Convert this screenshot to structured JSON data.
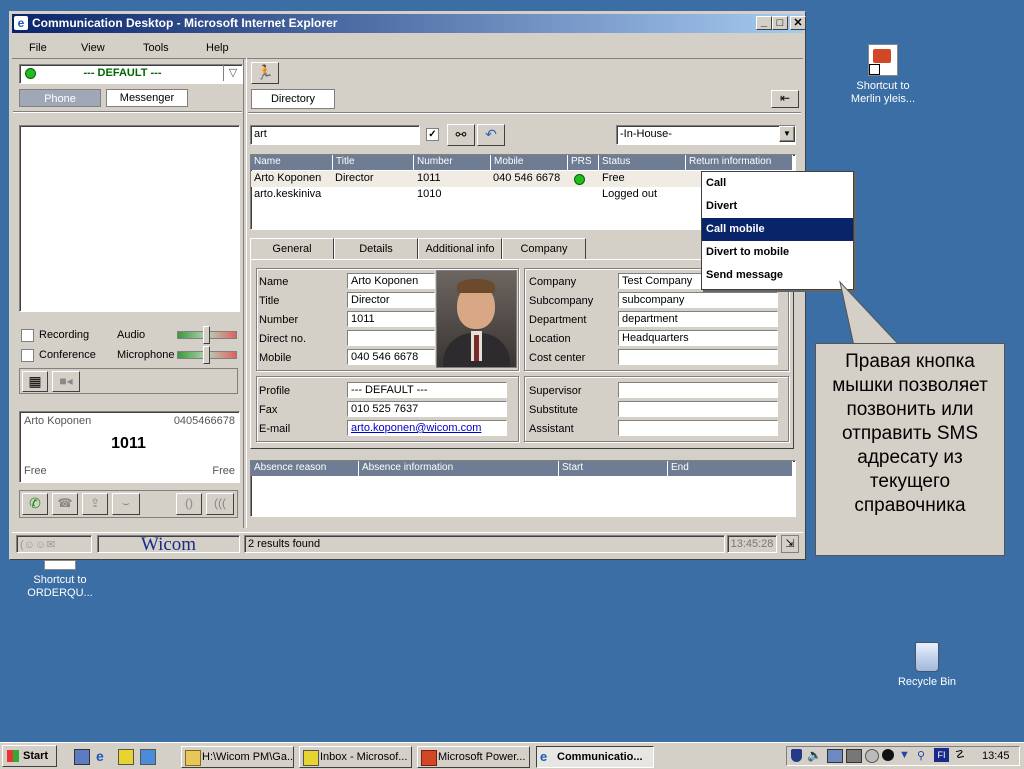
{
  "window": {
    "title": "Communication Desktop - Microsoft Internet Explorer"
  },
  "menu": [
    "File",
    "View",
    "Tools",
    "Help"
  ],
  "profile": {
    "selected": "--- DEFAULT ---"
  },
  "left_tabs": {
    "phone": "Phone",
    "messenger": "Messenger"
  },
  "options": {
    "recording": "Recording",
    "conference": "Conference",
    "audio": "Audio",
    "microphone": "Microphone"
  },
  "call_panel": {
    "name": "Arto Koponen",
    "mobile": "0405466678",
    "number": "1011",
    "status_left": "Free",
    "status_right": "Free"
  },
  "directory": {
    "tab": "Directory",
    "search_value": "art",
    "location": "-In-House-",
    "columns": [
      "Name",
      "Title",
      "Number",
      "Mobile",
      "PRS",
      "Status",
      "Return information"
    ],
    "rows": [
      {
        "name": "Arto Koponen",
        "title": "Director",
        "number": "1011",
        "mobile": "040 546 6678",
        "status": "Free",
        "presence_color": "#22bb22"
      },
      {
        "name": "arto.keskiniva",
        "title": "",
        "number": "1010",
        "mobile": "",
        "status": "Logged out",
        "presence_color": ""
      }
    ]
  },
  "context_menu": {
    "items": [
      "Call",
      "Divert",
      "Call mobile",
      "Divert to mobile",
      "Send message"
    ],
    "highlighted": "Call mobile"
  },
  "detail_tabs": [
    "General",
    "Details",
    "Additional info",
    "Company"
  ],
  "general": {
    "labels": {
      "name": "Name",
      "title": "Title",
      "number": "Number",
      "direct": "Direct no.",
      "mobile": "Mobile",
      "profile": "Profile",
      "fax": "Fax",
      "email": "E-mail"
    },
    "values": {
      "name": "Arto Koponen",
      "title": "Director",
      "number": "1011",
      "direct": "",
      "mobile": "040 546 6678",
      "profile": "--- DEFAULT ---",
      "fax": "010 525 7637",
      "email": "arto.koponen@wicom.com"
    }
  },
  "company": {
    "labels": {
      "company": "Company",
      "subcompany": "Subcompany",
      "department": "Department",
      "location": "Location",
      "cost_center": "Cost center",
      "supervisor": "Supervisor",
      "substitute": "Substitute",
      "assistant": "Assistant"
    },
    "values": {
      "company": "Test Company",
      "subcompany": "subcompany",
      "department": "department",
      "location": "Headquarters",
      "cost_center": "",
      "supervisor": "",
      "substitute": "",
      "assistant": ""
    }
  },
  "absence_columns": [
    "Absence reason",
    "Absence information",
    "Start",
    "End"
  ],
  "status_bar": {
    "brand": "Wicom",
    "results": "2 results found",
    "time": "13:45:28"
  },
  "callout": {
    "text": "Правая кнопка мышки позволяет позвонить или отправить SMS адресату из текущего справочника"
  },
  "desktop_icons": {
    "merlin": "Shortcut to Merlin yleis...",
    "order": "Shortcut to ORDERQU...",
    "recycle": "Recycle Bin"
  },
  "taskbar": {
    "start": "Start",
    "tasks": [
      "H:\\Wicom PM\\Ga...",
      "Inbox - Microsof...",
      "Microsoft Power...",
      "Communicatio..."
    ],
    "active_task": "Communicatio...",
    "clock": "13:45",
    "tray_lang": "FI"
  }
}
